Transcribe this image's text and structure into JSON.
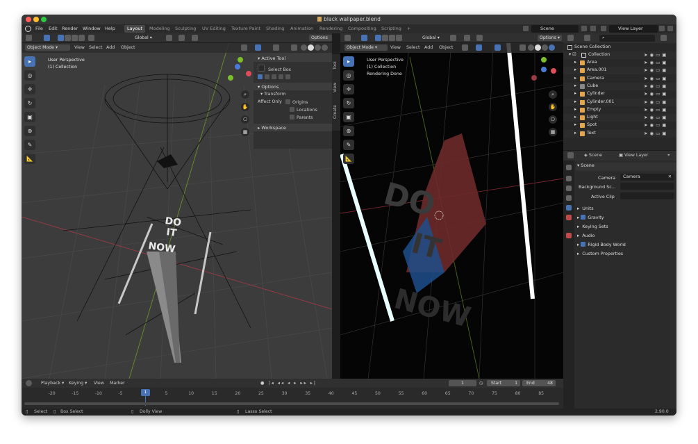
{
  "window": {
    "title": "black wallpaper.blend"
  },
  "menubar": {
    "menus": [
      "File",
      "Edit",
      "Render",
      "Window",
      "Help"
    ],
    "workspaces": [
      "Layout",
      "Modeling",
      "Sculpting",
      "UV Editing",
      "Texture Paint",
      "Shading",
      "Animation",
      "Rendering",
      "Compositing",
      "Scripting",
      "+"
    ],
    "active_workspace": "Layout",
    "scene": "Scene",
    "view_layer": "View Layer"
  },
  "viewport_left": {
    "orientation": "Global",
    "options": "Options",
    "mode": "Object Mode",
    "menus": [
      "View",
      "Select",
      "Add",
      "Object"
    ],
    "info": [
      "User Perspective",
      "(1) Collection"
    ]
  },
  "npanel": {
    "active_tool_header": "Active Tool",
    "tool_name": "Select Box",
    "options_header": "Options",
    "transform_header": "Transform",
    "affect_only": "Affect Only",
    "checkboxes": [
      "Origins",
      "Locations",
      "Parents"
    ],
    "workspace_header": "Workspace",
    "side_tabs": [
      "Tool",
      "View",
      "Create"
    ]
  },
  "viewport_right": {
    "orientation": "Global",
    "options": "Options",
    "mode": "Object Mode",
    "menus": [
      "View",
      "Select",
      "Add",
      "Object"
    ],
    "info": [
      "User Perspective",
      "(1) Collection",
      "Rendering Done"
    ],
    "render_text": [
      "DO",
      "IT",
      "NOW"
    ]
  },
  "scene_text_left": [
    "DO",
    "IT",
    "NOW"
  ],
  "outliner": {
    "root": "Scene Collection",
    "collection": "Collection",
    "items": [
      {
        "name": "Area",
        "icon_color": "#e3a54d"
      },
      {
        "name": "Area.001",
        "icon_color": "#e3a54d"
      },
      {
        "name": "Camera",
        "icon_color": "#e3a54d"
      },
      {
        "name": "Cube",
        "icon_color": "#888888"
      },
      {
        "name": "Cylinder",
        "icon_color": "#e3a54d"
      },
      {
        "name": "Cylinder.001",
        "icon_color": "#e3a54d"
      },
      {
        "name": "Empty",
        "icon_color": "#e3a54d"
      },
      {
        "name": "Light",
        "icon_color": "#e3a54d"
      },
      {
        "name": "Spot",
        "icon_color": "#e3a54d"
      },
      {
        "name": "Text",
        "icon_color": "#e3a54d"
      }
    ]
  },
  "properties": {
    "header_scene": "Scene",
    "header_view_layer": "View Layer",
    "section": "Scene",
    "camera_label": "Camera",
    "camera_value": "Camera",
    "background_label": "Background Sc...",
    "active_clip_label": "Active Clip",
    "subsections": [
      "Units",
      "Gravity",
      "Keying Sets",
      "Audio",
      "Rigid Body World",
      "Custom Properties"
    ]
  },
  "timeline": {
    "menus": [
      "Playback",
      "Keying",
      "View",
      "Marker"
    ],
    "current_frame": "1",
    "start_label": "Start",
    "start": "1",
    "end_label": "End",
    "end": "48",
    "ticks": [
      "-20",
      "-15",
      "-10",
      "-5",
      "5",
      "10",
      "15",
      "20",
      "25",
      "30",
      "35",
      "40",
      "45",
      "50",
      "55",
      "60",
      "65",
      "70",
      "75",
      "80",
      "85"
    ],
    "cursor": "1"
  },
  "statusbar": {
    "select": "Select",
    "box_select": "Box Select",
    "dolly_view": "Dolly View",
    "lasso_select": "Lasso Select",
    "version": "2.90.0"
  },
  "colors": {
    "accent": "#4772b3",
    "x_axis": "#cc3344",
    "y_axis": "#7cbf2b",
    "object_icon": "#e3a54d"
  }
}
